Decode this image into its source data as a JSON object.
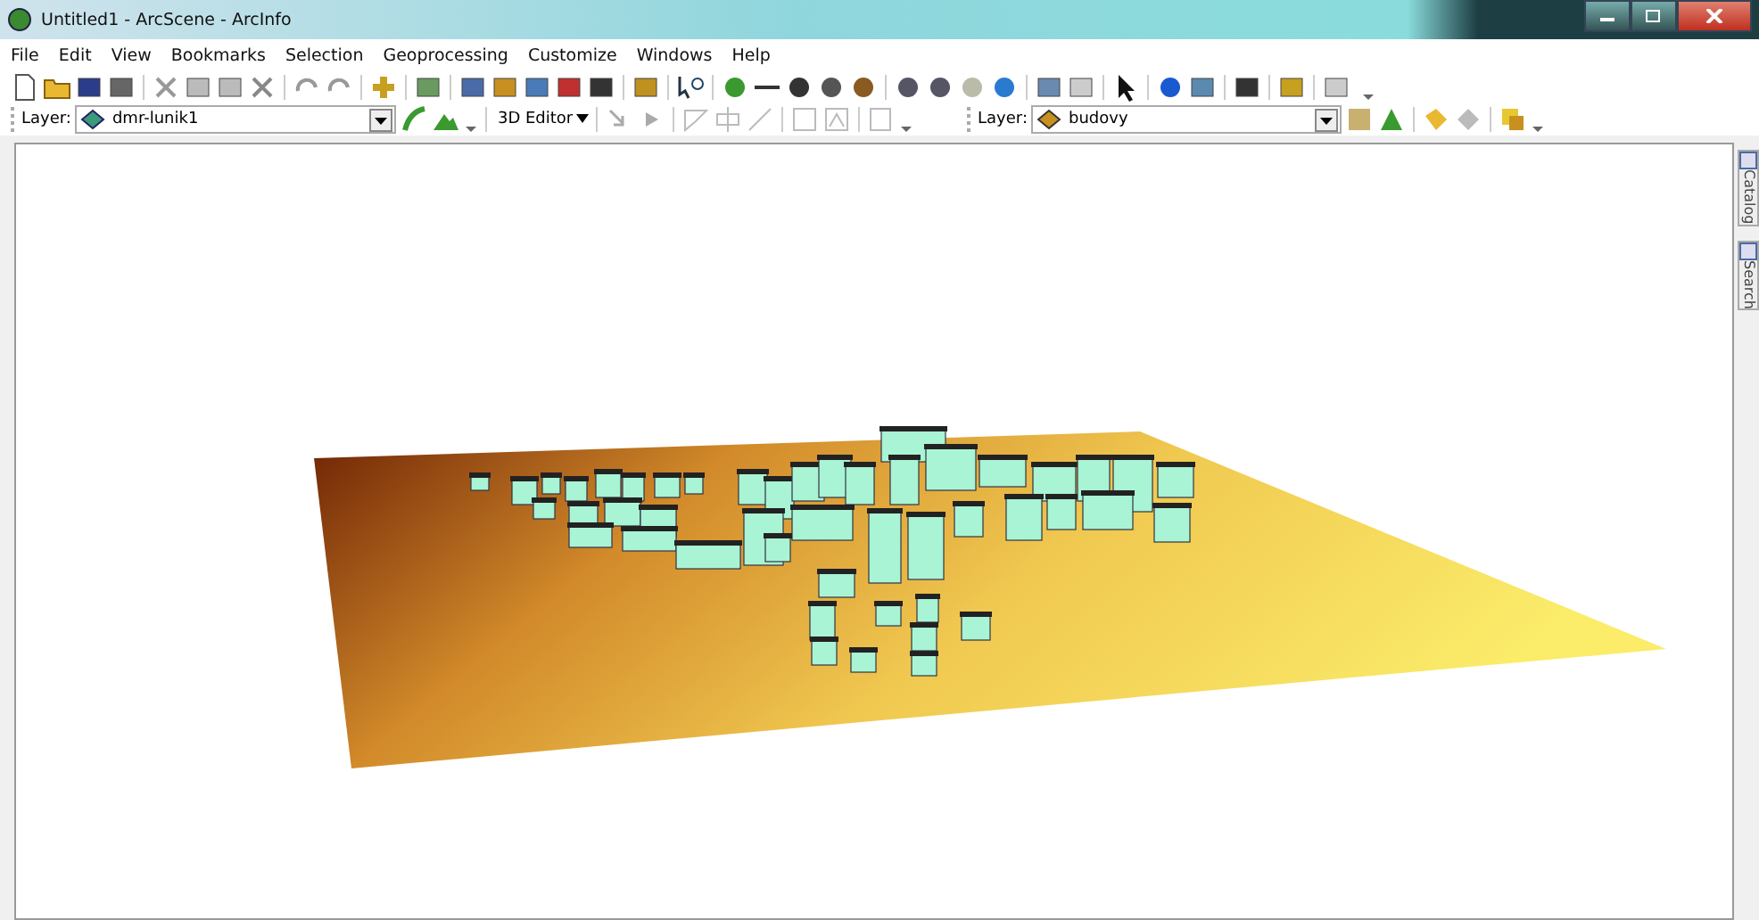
{
  "window": {
    "title": "Untitled1 - ArcScene - ArcInfo"
  },
  "menu": [
    "File",
    "Edit",
    "View",
    "Bookmarks",
    "Selection",
    "Geoprocessing",
    "Customize",
    "Windows",
    "Help"
  ],
  "scene_toolbar": {
    "label": "Layer:",
    "layer": "dmr-lunik1",
    "editor": "3D Editor"
  },
  "layer_toolbar": {
    "label": "Layer:",
    "layer": "budovy"
  },
  "side_tabs": [
    "Catalog",
    "Search"
  ]
}
